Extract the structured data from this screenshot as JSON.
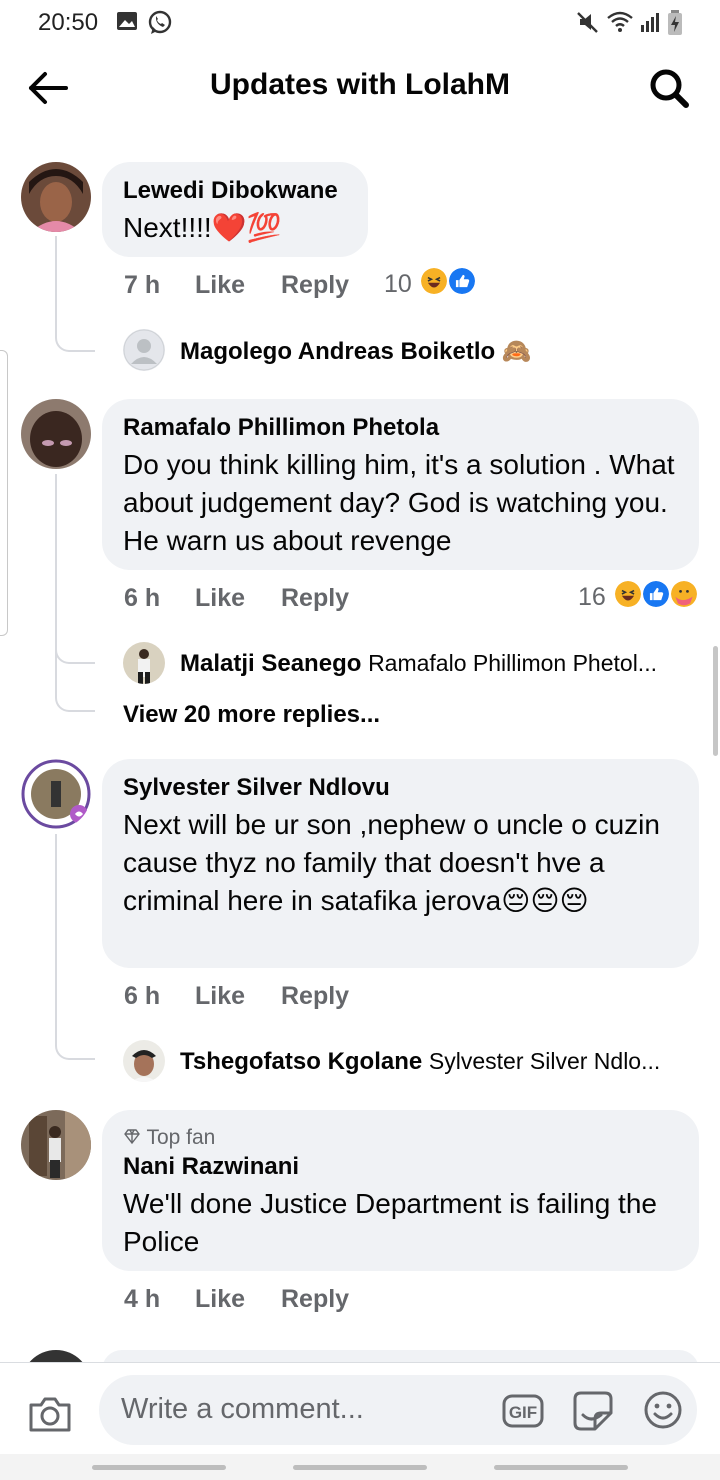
{
  "status_bar": {
    "time": "20:50",
    "left_icons": [
      "gallery-icon",
      "whatsapp-icon"
    ],
    "right_icons": [
      "mute-icon",
      "wifi-icon",
      "signal-icon",
      "battery-charging-icon"
    ]
  },
  "header": {
    "title": "Updates with LolahM",
    "back_icon": "arrow-left-icon",
    "search_icon": "search-icon"
  },
  "comments": [
    {
      "author": "Lewedi Dibokwane",
      "text": "Next!!!!❤️💯",
      "time": "7 h",
      "like": "Like",
      "reply": "Reply",
      "reaction_count": "10",
      "reactions": [
        "haha",
        "like"
      ],
      "replies": [
        {
          "author": "Magolego Andreas Boiketlo",
          "emoji": "🙈",
          "snippet": ""
        }
      ]
    },
    {
      "author": "Ramafalo Phillimon Phetola",
      "text": "Do you think killing him, it's a solution . What about judgement day? God is watching you. He warn us about revenge",
      "time": "6 h",
      "like": "Like",
      "reply": "Reply",
      "reaction_count": "16",
      "reactions": [
        "haha",
        "like",
        "care"
      ],
      "replies": [
        {
          "author": "Malatji Seanego",
          "snippet": "Ramafalo Phillimon Phetol..."
        }
      ],
      "more_replies": "View 20 more replies..."
    },
    {
      "author": "Sylvester Silver Ndlovu",
      "text": "Next will be ur son ,nephew o uncle o cuzin cause thyz no family that doesn't hve a criminal here in satafika jerova😔😔😔",
      "time": "6 h",
      "like": "Like",
      "reply": "Reply",
      "avatar_frame": "LET'S GET VACCINATED",
      "replies": [
        {
          "author": "Tshegofatso Kgolane",
          "snippet": "Sylvester Silver Ndlo..."
        }
      ]
    },
    {
      "badge": "Top fan",
      "badge_icon": "diamond-icon",
      "author": "Nani Razwinani",
      "text": "We'll done Justice Department is failing the Police",
      "time": "4 h",
      "like": "Like",
      "reply": "Reply"
    }
  ],
  "composer": {
    "placeholder": "Write a comment...",
    "camera_icon": "camera-icon",
    "gif_label": "GIF",
    "sticker_icon": "sticker-icon",
    "emoji_icon": "emoji-icon"
  },
  "colors": {
    "bubble": "#f0f2f5",
    "secondary_text": "#65676b",
    "primary_text": "#050505",
    "like_blue": "#1877f2",
    "haha_yellow": "#f7b125"
  }
}
